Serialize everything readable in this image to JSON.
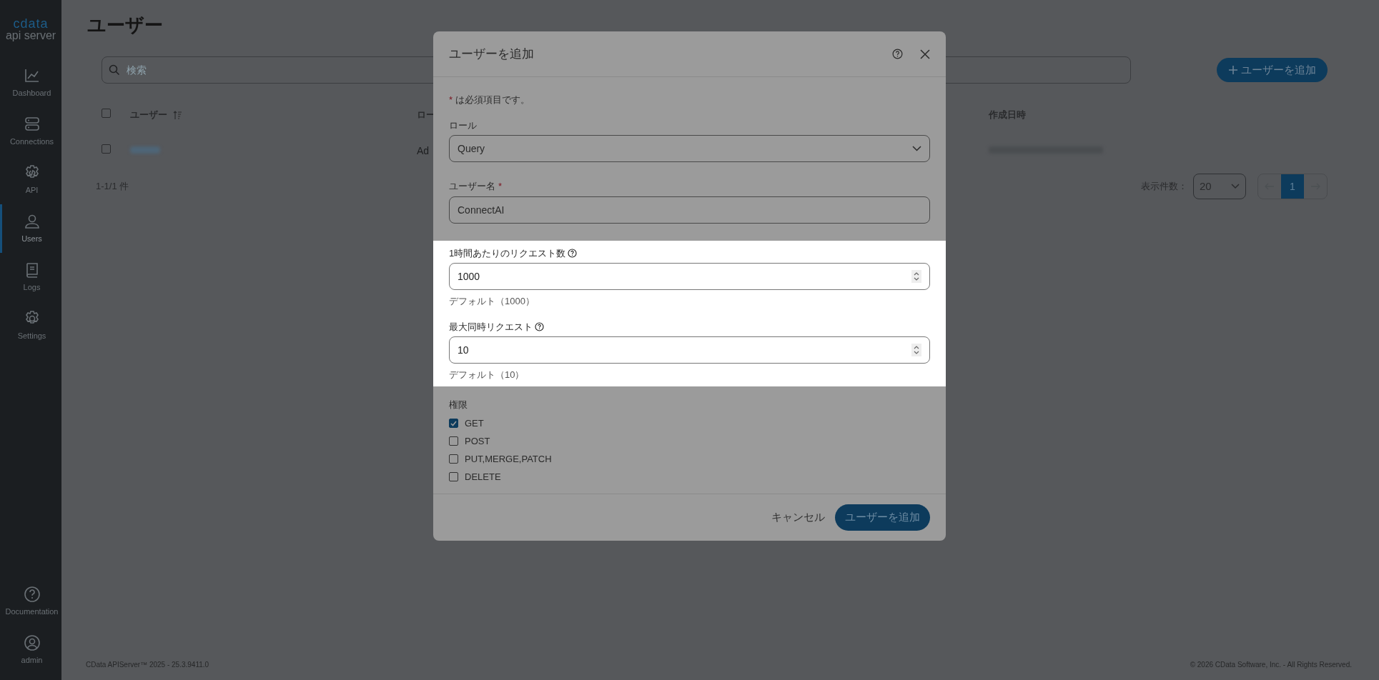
{
  "sidebar": {
    "logo_top": "cdata",
    "logo_bottom": "api server",
    "items": [
      {
        "label": "Dashboard",
        "selected": false
      },
      {
        "label": "Connections",
        "selected": false
      },
      {
        "label": "API",
        "selected": false
      },
      {
        "label": "Users",
        "selected": true
      },
      {
        "label": "Logs",
        "selected": false
      },
      {
        "label": "Settings",
        "selected": false
      }
    ],
    "bottom_items": [
      {
        "label": "Documentation"
      },
      {
        "label": "admin"
      }
    ]
  },
  "page": {
    "title": "ユーザー",
    "search": {
      "placeholder": "検索"
    },
    "add_button": "ユーザーを追加",
    "table": {
      "header_checked": false,
      "columns": [
        "ユーザー",
        "ロー",
        "作成日時"
      ],
      "rows": [
        {
          "checked": false,
          "role": "Ad"
        }
      ]
    },
    "count": "1-1/1 件",
    "page_size_label": "表示件数：",
    "page_size": "20",
    "pages": [
      {
        "label": "1",
        "selected": true
      }
    ]
  },
  "dialog": {
    "title": "ユーザーを追加",
    "required_mark": "*",
    "required_note": "は必須項目です。",
    "fields": [
      {
        "kind": "select",
        "label": "ロール",
        "required": false,
        "value": "Query",
        "highlighted": false
      },
      {
        "kind": "text",
        "label": "ユーザー名",
        "required": true,
        "value": "ConnectAI",
        "highlighted": false
      },
      {
        "kind": "number",
        "label": "1時間あたりのリクエスト数",
        "required": false,
        "help": true,
        "value": "1000",
        "hint": "デフォルト（1000）",
        "highlighted": true
      },
      {
        "kind": "number",
        "label": "最大同時リクエスト",
        "required": false,
        "help": true,
        "value": "10",
        "hint": "デフォルト（10）",
        "highlighted": true
      }
    ],
    "permissions": {
      "label": "権限",
      "options": [
        {
          "label": "GET",
          "checked": true
        },
        {
          "label": "POST",
          "checked": false
        },
        {
          "label": "PUT,MERGE,PATCH",
          "checked": false
        },
        {
          "label": "DELETE",
          "checked": false
        }
      ]
    },
    "cancel": "キャンセル",
    "submit": "ユーザーを追加"
  },
  "footer": {
    "left": "CData APIServer™ 2025 - 25.3.9411.0",
    "right": "© 2026 CData Software, Inc. - All Rights Reserved."
  }
}
